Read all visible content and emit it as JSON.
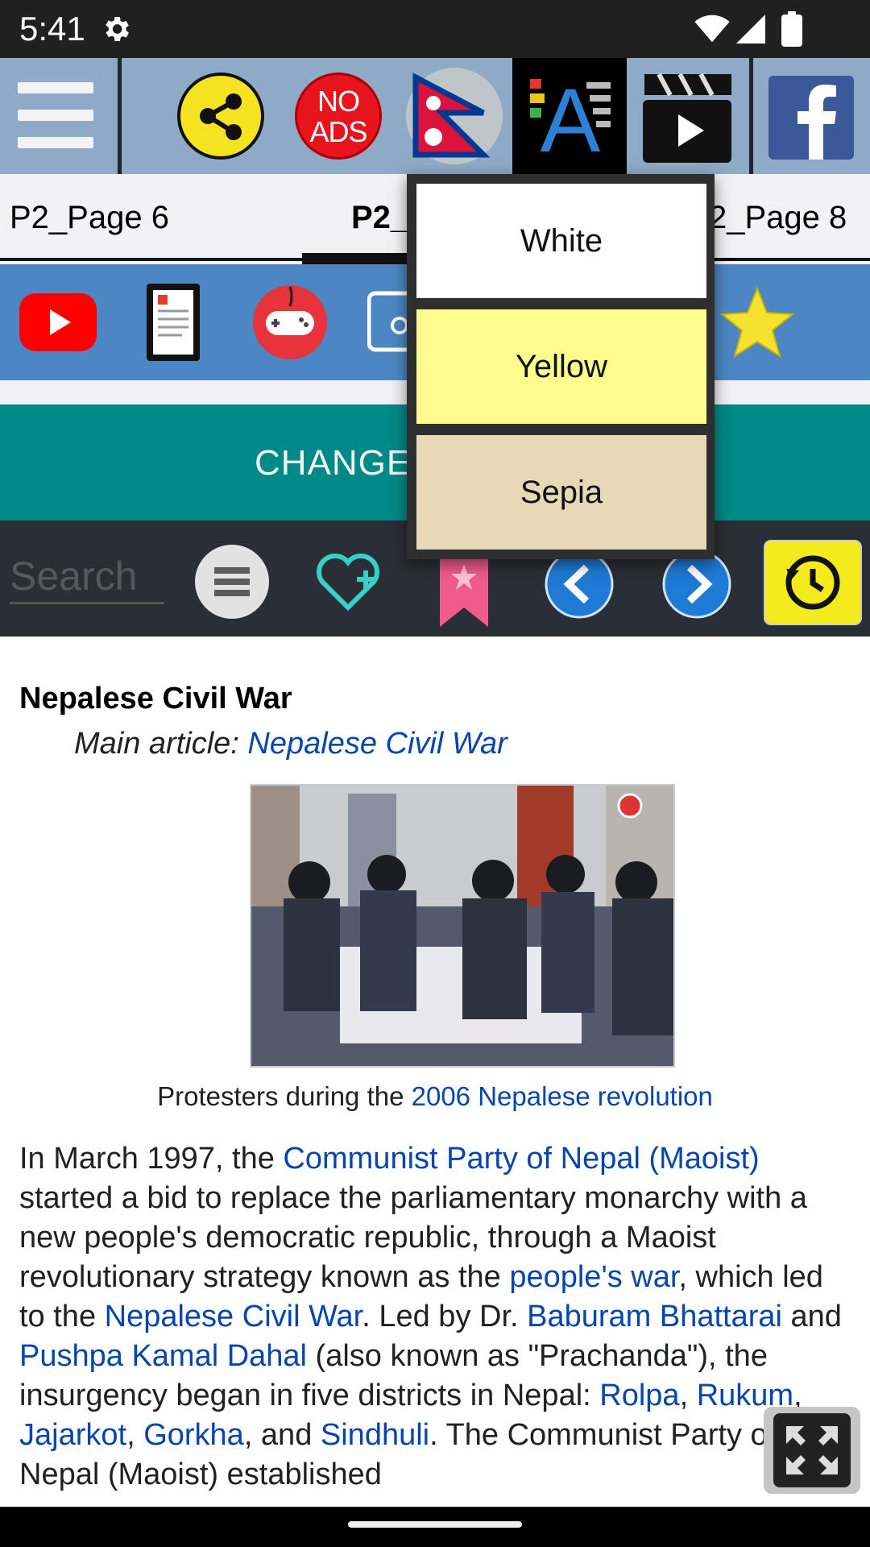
{
  "status_bar": {
    "time": "5:41"
  },
  "toolbar": {
    "noads_line1": "NO",
    "noads_line2": "ADS"
  },
  "tabs": [
    {
      "label": "P2_Page 6"
    },
    {
      "label": "P2_"
    },
    {
      "label": "2_Page 8"
    }
  ],
  "change_bar": {
    "label": "CHANGE"
  },
  "search": {
    "placeholder": "Search"
  },
  "color_menu": {
    "options": [
      {
        "label": "White",
        "color": "#ffffff"
      },
      {
        "label": "Yellow",
        "color": "#fdfc8c"
      },
      {
        "label": "Sepia",
        "color": "#e7d8b8"
      }
    ]
  },
  "article": {
    "heading": "Nepalese Civil War",
    "main_article_prefix": "Main article: ",
    "main_article_link": "Nepalese Civil War",
    "caption_prefix": "Protesters during the ",
    "caption_link": "2006 Nepalese revolution",
    "p": {
      "t1": "In March 1997, the ",
      "l1": "Communist Party of Nepal (Maoist)",
      "t2": " started a bid to replace the parliamentary monarchy with a new people's democratic republic, through a Maoist revolutionary strategy known as the ",
      "l2": "people's war",
      "t3": ", which led to the ",
      "l3": "Nepalese Civil War",
      "t4": ". Led by Dr. ",
      "l4": "Baburam Bhattarai",
      "t5": " and ",
      "l5": "Pushpa Kamal Dahal",
      "t6": " (also known as \"Prachanda\"), the insurgency began in five districts in Nepal: ",
      "l6": "Rolpa",
      "t7": ", ",
      "l7": "Rukum",
      "t8": ", ",
      "l8": "Jajarkot",
      "t9": ", ",
      "l9": "Gorkha",
      "t10": ", and ",
      "l10": "Sindhuli",
      "t11": ". The Communist Party of Nepal (Maoist) established"
    }
  },
  "colors": {
    "toolbar": "#8faac6",
    "icon_row": "#4d87c3",
    "change_bar": "#008a87",
    "link": "#0645ad"
  }
}
